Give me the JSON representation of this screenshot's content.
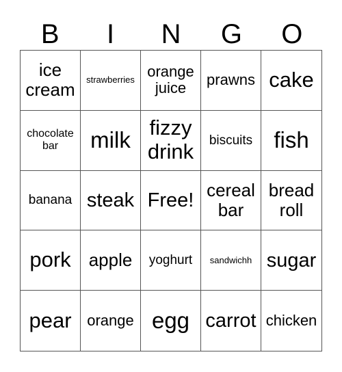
{
  "header": [
    "B",
    "I",
    "N",
    "G",
    "O"
  ],
  "cells": [
    "ice cream",
    "strawberries",
    "orange juice",
    "prawns",
    "cake",
    "chocolate bar",
    "milk",
    "fizzy drink",
    "biscuits",
    "fish",
    "banana",
    "steak",
    "Free!",
    "cereal bar",
    "bread roll",
    "pork",
    "apple",
    "yoghurt",
    "sandwichh",
    "sugar",
    "pear",
    "orange",
    "egg",
    "carrot",
    "chicken"
  ]
}
